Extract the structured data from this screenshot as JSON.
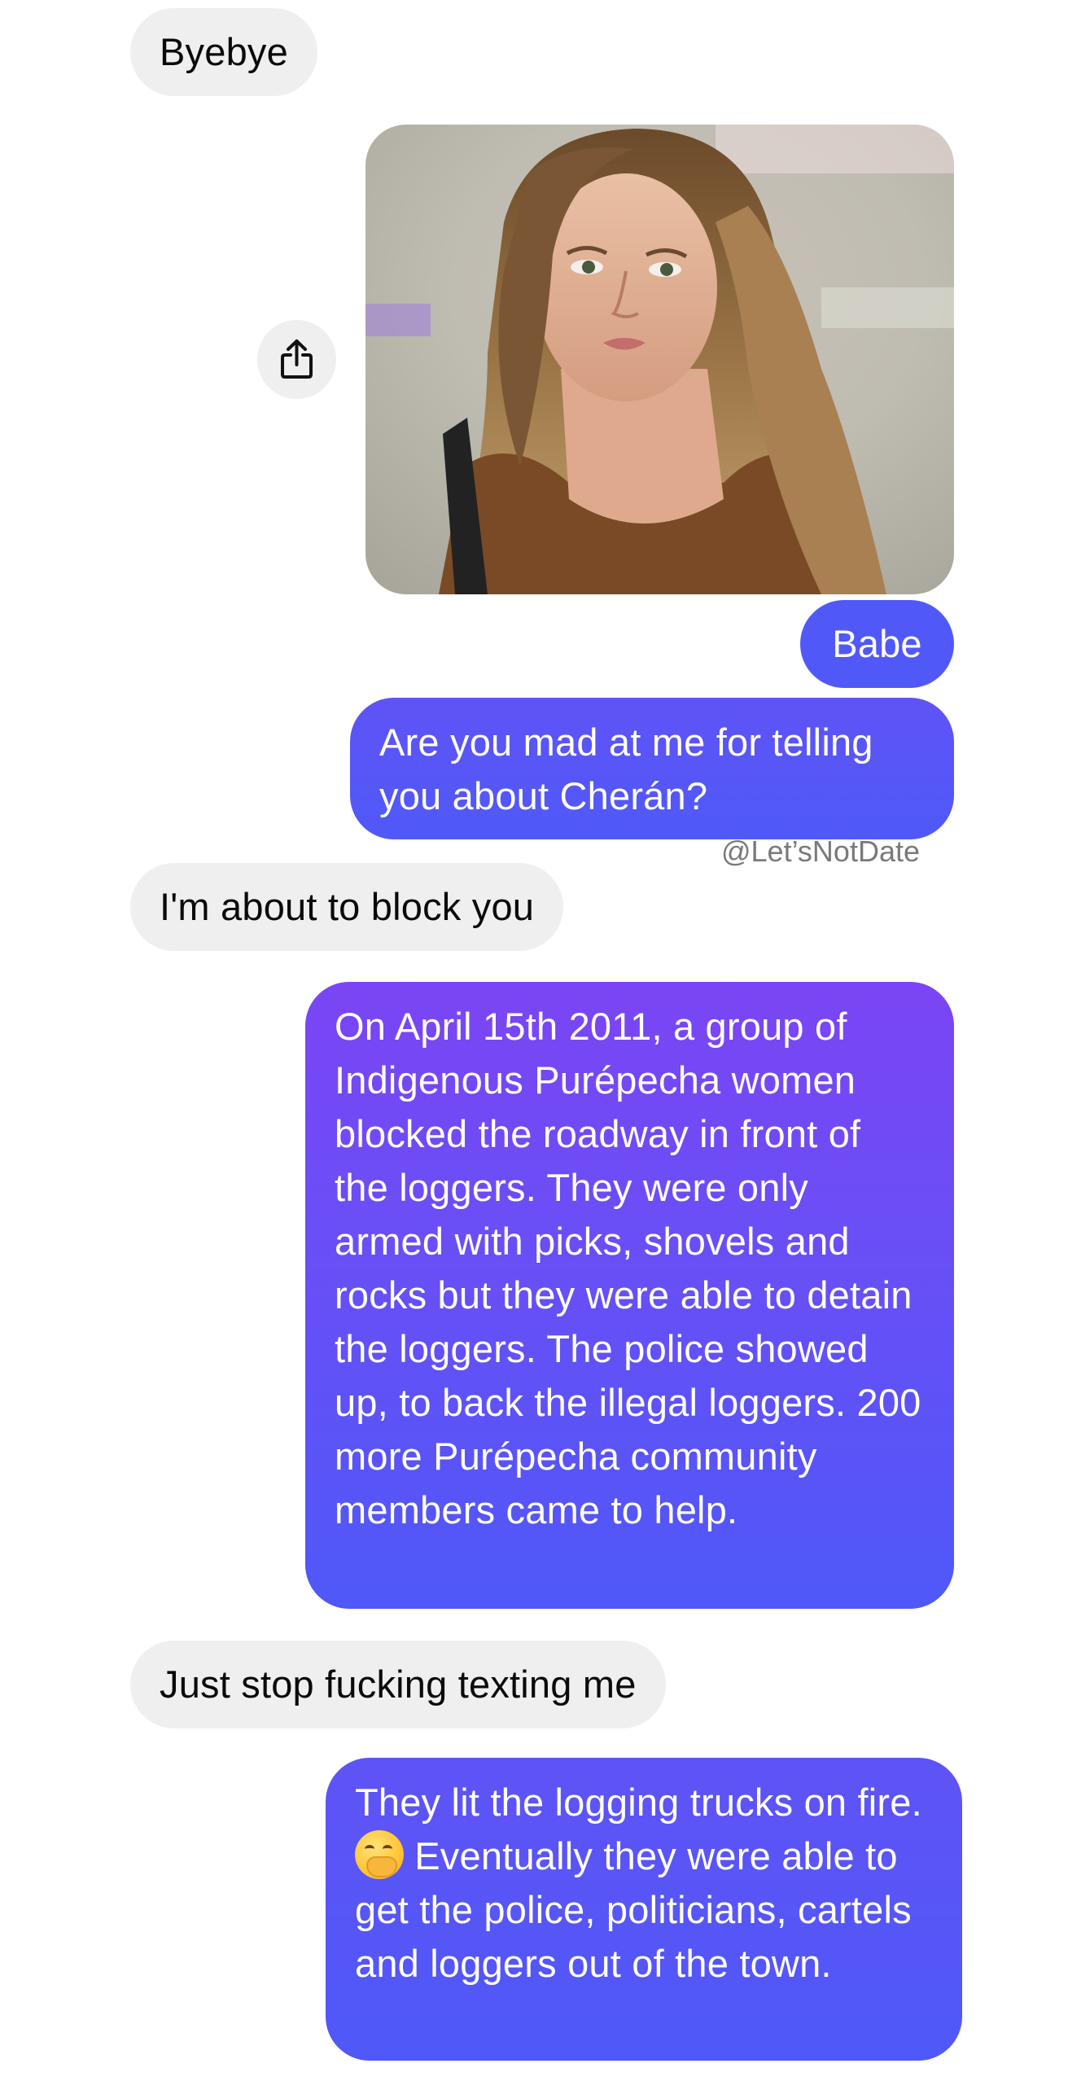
{
  "messages": {
    "m1": {
      "text": "Byebye"
    },
    "m3": {
      "text": "Babe"
    },
    "m4": {
      "text": "Are you mad at me for telling you about Cherán?"
    },
    "m5": {
      "text": "I'm about to block you"
    },
    "m6": {
      "text": "On April 15th 2011, a group of Indigenous Purépecha women blocked the roadway in front of the loggers. They were only armed with picks, shovels and rocks but they were able to detain the loggers. The police showed up, to back the illegal loggers. 200 more Purépecha community members came to help."
    },
    "m7": {
      "text": "Just stop fucking texting me"
    },
    "m8": {
      "text_before": "They lit the logging trucks on fire. ",
      "text_after": " Eventually they were able to get the police, politicians, cartels and loggers out of the town."
    }
  },
  "watermark": "@Let’sNotDate",
  "icons": {
    "share": "share-icon",
    "emoji": "hand-over-mouth-emoji"
  },
  "colors": {
    "incoming_bubble": "#efefef",
    "outgoing_top": "#7b45f4",
    "outgoing_bottom": "#4f58f8"
  }
}
